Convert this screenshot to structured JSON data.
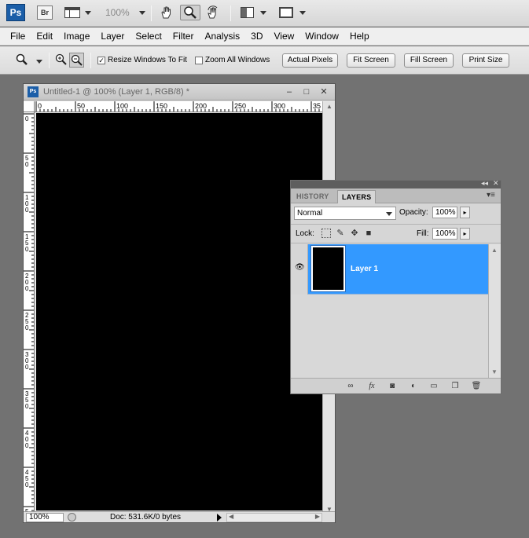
{
  "appbar": {
    "logo": "Ps",
    "bridge": "Br",
    "zoom_level": "100%",
    "icons": [
      "layout-icon",
      "hand-tool-icon",
      "zoom-tool-icon",
      "rotate-view-icon",
      "arrange-documents-icon",
      "screen-mode-icon"
    ]
  },
  "menu": {
    "items": [
      "File",
      "Edit",
      "Image",
      "Layer",
      "Select",
      "Filter",
      "Analysis",
      "3D",
      "View",
      "Window",
      "Help"
    ]
  },
  "options": {
    "resize_windows_label": "Resize Windows To Fit",
    "resize_windows_checked": true,
    "zoom_all_label": "Zoom All Windows",
    "zoom_all_checked": false,
    "actual_pixels": "Actual Pixels",
    "fit_screen": "Fit Screen",
    "fill_screen": "Fill Screen",
    "print_size": "Print Size"
  },
  "document": {
    "title": "Untitled-1 @ 100% (Layer 1, RGB/8) *",
    "icon_text": "Ps",
    "ruler_top": [
      "0",
      "50",
      "100",
      "150",
      "200",
      "250",
      "300",
      "35"
    ],
    "ruler_left": [
      "0",
      "50",
      "100",
      "150",
      "200",
      "250",
      "300",
      "350",
      "400",
      "450",
      "500"
    ],
    "zoom": "100%",
    "doc_info": "Doc: 531.6K/0 bytes",
    "canvas_color": "#000000"
  },
  "layers_panel": {
    "tabs": [
      "HISTORY",
      "LAYERS"
    ],
    "active_tab": "LAYERS",
    "blend_mode": "Normal",
    "opacity_label": "Opacity:",
    "opacity": "100%",
    "lock_label": "Lock:",
    "fill_label": "Fill:",
    "fill": "100%",
    "layers": [
      {
        "name": "Layer 1",
        "visible": true,
        "selected": true
      }
    ],
    "selection_color": "#3399ff"
  }
}
